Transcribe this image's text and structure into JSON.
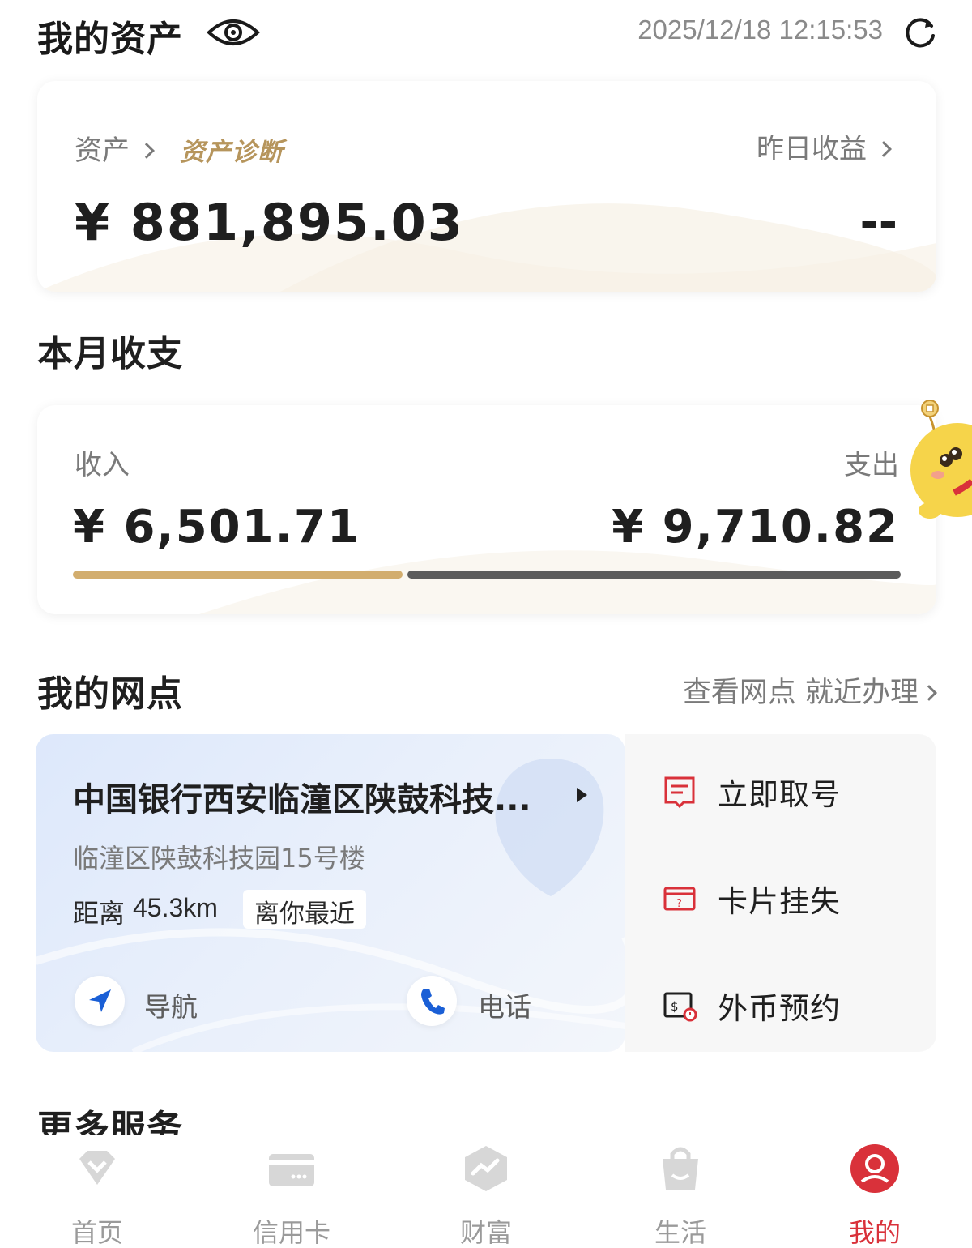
{
  "header": {
    "title": "我的资产",
    "timestamp": "2025/12/18 12:15:53",
    "eye_icon": "eye-icon",
    "refresh_icon": "refresh-icon"
  },
  "assets": {
    "label": "资产",
    "diagnosis": "资产诊断",
    "value": "¥ 881,895.03",
    "yesterday_label": "昨日收益",
    "yesterday_value": "--"
  },
  "monthly": {
    "title": "本月收支",
    "income_label": "收入",
    "expense_label": "支出",
    "income_value": "¥ 6,501.71",
    "expense_value": "¥ 9,710.82",
    "income_color": "#d2ad6e",
    "expense_color": "#5c5c5c"
  },
  "branch": {
    "title": "我的网点",
    "link": "查看网点 就近办理",
    "name": "中国银行西安临潼区陕鼓科技...",
    "address": "临潼区陕鼓科技园15号楼",
    "distance_label": "距离",
    "distance": "45.3km",
    "tag": "离你最近",
    "nav_label": "导航",
    "call_label": "电话"
  },
  "services": [
    {
      "label": "立即取号",
      "icon": "queue-ticket-icon"
    },
    {
      "label": "卡片挂失",
      "icon": "card-loss-icon"
    },
    {
      "label": "外币预约",
      "icon": "foreign-currency-icon"
    }
  ],
  "more": {
    "title": "更多服务"
  },
  "tabs": [
    {
      "label": "首页",
      "icon": "home-diamond-icon"
    },
    {
      "label": "信用卡",
      "icon": "credit-card-icon"
    },
    {
      "label": "财富",
      "icon": "wealth-icon"
    },
    {
      "label": "生活",
      "icon": "shopping-bag-icon"
    },
    {
      "label": "我的",
      "icon": "profile-icon",
      "active": true
    }
  ],
  "colors": {
    "accent": "#d9313a",
    "gold": "#b6955c",
    "nav_blue": "#1a5fd6"
  }
}
